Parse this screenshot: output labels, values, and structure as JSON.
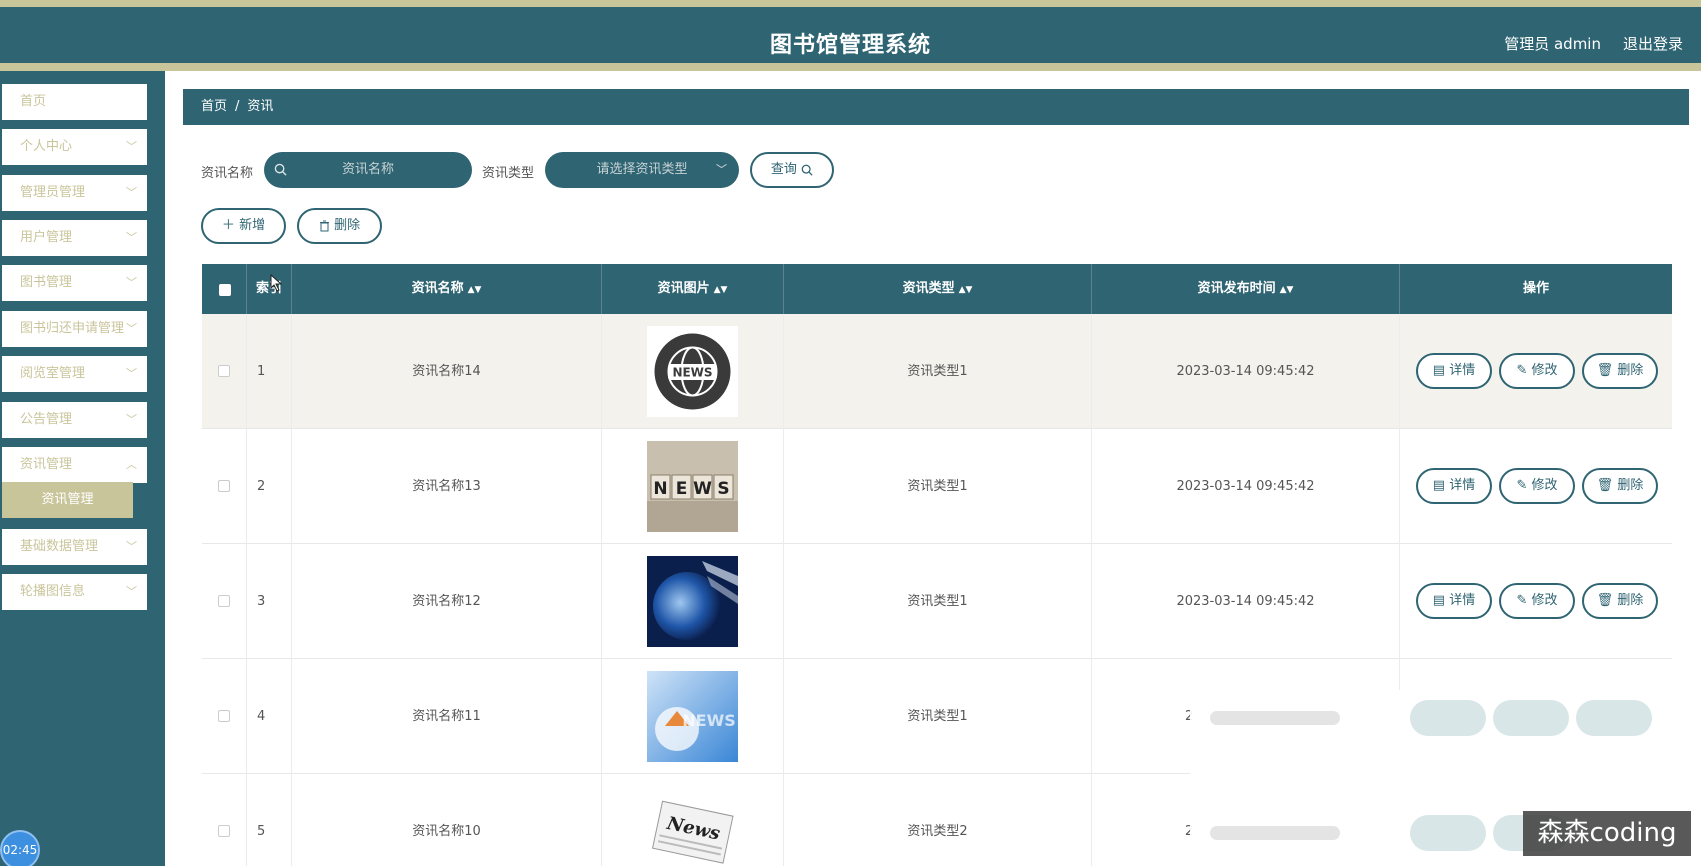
{
  "header": {
    "title": "图书馆管理系统",
    "user": "管理员 admin",
    "logout": "退出登录"
  },
  "sidebar": {
    "items": [
      {
        "label": "首页"
      },
      {
        "label": "个人中心"
      },
      {
        "label": "管理员管理"
      },
      {
        "label": "用户管理"
      },
      {
        "label": "图书管理"
      },
      {
        "label": "图书归还申请管理"
      },
      {
        "label": "阅览室管理"
      },
      {
        "label": "公告管理"
      },
      {
        "label": "资讯管理"
      },
      {
        "label": "基础数据管理"
      },
      {
        "label": "轮播图信息"
      }
    ],
    "active_sub": "资讯管理",
    "clock": "02:45"
  },
  "breadcrumb": {
    "home": "首页",
    "sep": "/",
    "current": "资讯"
  },
  "search": {
    "name_label": "资讯名称",
    "name_placeholder": "资讯名称",
    "type_label": "资讯类型",
    "type_placeholder": "请选择资讯类型",
    "query_button": "查询"
  },
  "actions": {
    "add": "新增",
    "delete": "删除"
  },
  "table": {
    "columns": [
      "索引",
      "资讯名称",
      "资讯图片",
      "资讯类型",
      "资讯发布时间",
      "操作"
    ],
    "rows": [
      {
        "index": "1",
        "name": "资讯名称14",
        "type": "资讯类型1",
        "time": "2023-03-14 09:45:42",
        "image": "news-globe-icon"
      },
      {
        "index": "2",
        "name": "资讯名称13",
        "type": "资讯类型1",
        "time": "2023-03-14 09:45:42",
        "image": "news-blocks-image"
      },
      {
        "index": "3",
        "name": "资讯名称12",
        "type": "资讯类型1",
        "time": "2023-03-14 09:45:42",
        "image": "globe-blue-image"
      },
      {
        "index": "4",
        "name": "资讯名称11",
        "type": "资讯类型1",
        "time": "2",
        "image": "news-blue-image"
      },
      {
        "index": "5",
        "name": "资讯名称10",
        "type": "资讯类型2",
        "time": "2",
        "image": "newspaper-image"
      }
    ],
    "op_detail": "详情",
    "op_edit": "修改",
    "op_delete": "删除"
  },
  "watermark": "森森coding",
  "colors": {
    "primary": "#2f6472",
    "accent": "#c9c59b"
  }
}
